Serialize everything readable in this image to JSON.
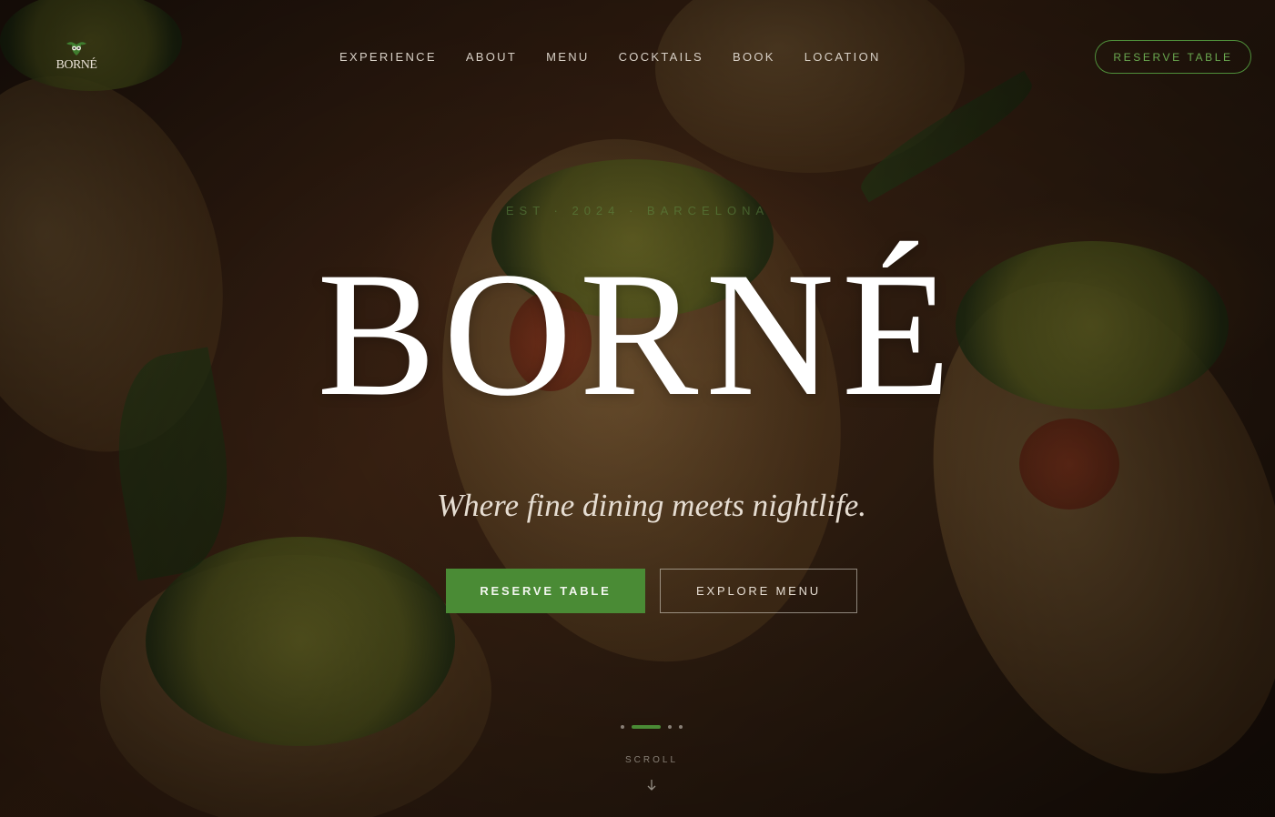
{
  "brand": {
    "logo_text": "BORNÉ"
  },
  "nav": {
    "items": [
      {
        "label": "EXPERIENCE"
      },
      {
        "label": "ABOUT"
      },
      {
        "label": "MENU"
      },
      {
        "label": "COCKTAILS"
      },
      {
        "label": "BOOK"
      },
      {
        "label": "LOCATION"
      }
    ],
    "reserve_label": "RESERVE TABLE"
  },
  "hero": {
    "eyebrow": "EST · 2024 · BARCELONA",
    "title": "BORNÉ",
    "tagline": "Where fine dining meets nightlife.",
    "primary_button": "RESERVE TABLE",
    "secondary_button": "EXPLORE MENU",
    "slides": {
      "count": 4,
      "active_index": 1
    },
    "scroll_label": "SCROLL"
  },
  "colors": {
    "accent_green": "#4a8b35",
    "outline_green": "#4f8f3a",
    "text_light": "#e6ddd2"
  },
  "icons": {
    "logo": "owl-leaf-icon",
    "scroll": "arrow-down-icon"
  }
}
